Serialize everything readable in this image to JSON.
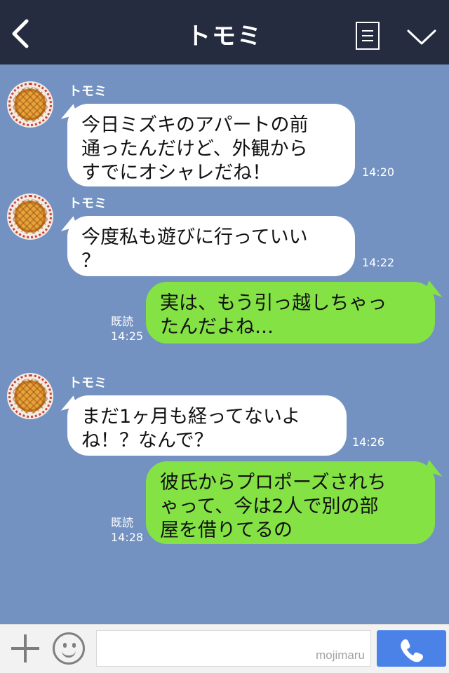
{
  "header": {
    "title": "トモミ"
  },
  "messages": [
    {
      "sender": "トモミ",
      "lines": [
        "今日ミズキのアパートの前",
        "通ったんだけど、外観から",
        "すでにオシャレだね！"
      ],
      "time": "14:20"
    },
    {
      "sender": "トモミ",
      "lines": [
        "今度私も遊びに行っていい",
        "？"
      ],
      "time": "14:22"
    },
    {
      "lines": [
        "実は、もう引っ越しちゃっ",
        "たんだよね…"
      ],
      "read": "既読",
      "time": "14:25"
    },
    {
      "sender": "トモミ",
      "lines": [
        "まだ1ヶ月も経ってないよ",
        "ね！？なんで？"
      ],
      "time": "14:26"
    },
    {
      "lines": [
        "彼氏からプロポーズされち",
        "ゃって、今は2人で別の部",
        "屋を借りてるの"
      ],
      "read": "既読",
      "time": "14:28"
    }
  ],
  "footer": {
    "watermark": "mojimaru"
  },
  "colors": {
    "background": "#7392c1",
    "header": "#252c3f",
    "outgoing_bubble": "#84e245",
    "incoming_bubble": "#ffffff",
    "send_button": "#4b82e8"
  },
  "icons": {
    "back": "chevron-left-icon",
    "menu": "menu-icon",
    "collapse": "chevron-down-icon",
    "add": "plus-icon",
    "emoji": "smiley-icon",
    "call": "phone-icon"
  }
}
